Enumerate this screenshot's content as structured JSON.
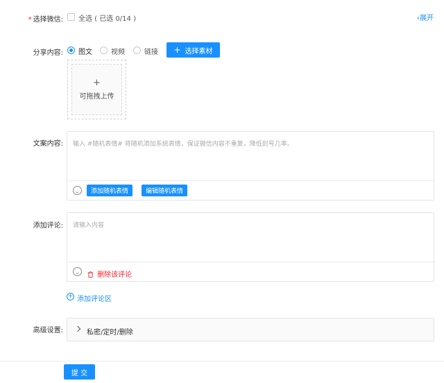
{
  "wechat": {
    "required_mark": "*",
    "label": "选择微信:",
    "select_all": "全选 ( 已选 0/14 )",
    "expand": "展开"
  },
  "share": {
    "label": "分享内容:",
    "options": [
      "图文",
      "视频",
      "链接"
    ],
    "selected": "图文",
    "select_material": "选择素材"
  },
  "upload": {
    "plus": "+",
    "hint": "可拖拽上传"
  },
  "copy": {
    "label": "文案内容:",
    "placeholder": "输入 #随机表情# 将随机添加系统表情，保证微信内容不重复，降低封号几率。",
    "add_emoji": "添加随机表情",
    "edit_emoji": "编辑随机表情"
  },
  "comment": {
    "label": "添加评论:",
    "placeholder": "请输入内容",
    "delete": "删除该评论",
    "add_area": "添加评论区"
  },
  "advanced": {
    "label": "高级设置:",
    "panel": "私密/定时/删除"
  },
  "submit": "提 交",
  "colors": {
    "primary": "#1890ff",
    "danger": "#f5222d"
  }
}
